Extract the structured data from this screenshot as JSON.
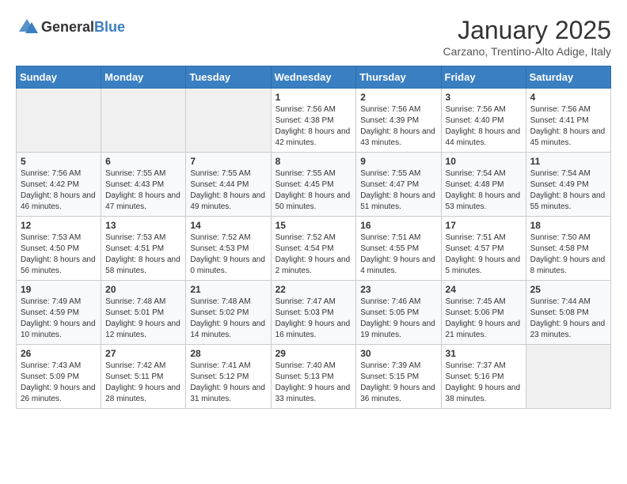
{
  "header": {
    "logo_general": "General",
    "logo_blue": "Blue",
    "month": "January 2025",
    "location": "Carzano, Trentino-Alto Adige, Italy"
  },
  "days_of_week": [
    "Sunday",
    "Monday",
    "Tuesday",
    "Wednesday",
    "Thursday",
    "Friday",
    "Saturday"
  ],
  "weeks": [
    [
      {
        "day": "",
        "sunrise": "",
        "sunset": "",
        "daylight": ""
      },
      {
        "day": "",
        "sunrise": "",
        "sunset": "",
        "daylight": ""
      },
      {
        "day": "",
        "sunrise": "",
        "sunset": "",
        "daylight": ""
      },
      {
        "day": "1",
        "sunrise": "Sunrise: 7:56 AM",
        "sunset": "Sunset: 4:38 PM",
        "daylight": "Daylight: 8 hours and 42 minutes."
      },
      {
        "day": "2",
        "sunrise": "Sunrise: 7:56 AM",
        "sunset": "Sunset: 4:39 PM",
        "daylight": "Daylight: 8 hours and 43 minutes."
      },
      {
        "day": "3",
        "sunrise": "Sunrise: 7:56 AM",
        "sunset": "Sunset: 4:40 PM",
        "daylight": "Daylight: 8 hours and 44 minutes."
      },
      {
        "day": "4",
        "sunrise": "Sunrise: 7:56 AM",
        "sunset": "Sunset: 4:41 PM",
        "daylight": "Daylight: 8 hours and 45 minutes."
      }
    ],
    [
      {
        "day": "5",
        "sunrise": "Sunrise: 7:56 AM",
        "sunset": "Sunset: 4:42 PM",
        "daylight": "Daylight: 8 hours and 46 minutes."
      },
      {
        "day": "6",
        "sunrise": "Sunrise: 7:55 AM",
        "sunset": "Sunset: 4:43 PM",
        "daylight": "Daylight: 8 hours and 47 minutes."
      },
      {
        "day": "7",
        "sunrise": "Sunrise: 7:55 AM",
        "sunset": "Sunset: 4:44 PM",
        "daylight": "Daylight: 8 hours and 49 minutes."
      },
      {
        "day": "8",
        "sunrise": "Sunrise: 7:55 AM",
        "sunset": "Sunset: 4:45 PM",
        "daylight": "Daylight: 8 hours and 50 minutes."
      },
      {
        "day": "9",
        "sunrise": "Sunrise: 7:55 AM",
        "sunset": "Sunset: 4:47 PM",
        "daylight": "Daylight: 8 hours and 51 minutes."
      },
      {
        "day": "10",
        "sunrise": "Sunrise: 7:54 AM",
        "sunset": "Sunset: 4:48 PM",
        "daylight": "Daylight: 8 hours and 53 minutes."
      },
      {
        "day": "11",
        "sunrise": "Sunrise: 7:54 AM",
        "sunset": "Sunset: 4:49 PM",
        "daylight": "Daylight: 8 hours and 55 minutes."
      }
    ],
    [
      {
        "day": "12",
        "sunrise": "Sunrise: 7:53 AM",
        "sunset": "Sunset: 4:50 PM",
        "daylight": "Daylight: 8 hours and 56 minutes."
      },
      {
        "day": "13",
        "sunrise": "Sunrise: 7:53 AM",
        "sunset": "Sunset: 4:51 PM",
        "daylight": "Daylight: 8 hours and 58 minutes."
      },
      {
        "day": "14",
        "sunrise": "Sunrise: 7:52 AM",
        "sunset": "Sunset: 4:53 PM",
        "daylight": "Daylight: 9 hours and 0 minutes."
      },
      {
        "day": "15",
        "sunrise": "Sunrise: 7:52 AM",
        "sunset": "Sunset: 4:54 PM",
        "daylight": "Daylight: 9 hours and 2 minutes."
      },
      {
        "day": "16",
        "sunrise": "Sunrise: 7:51 AM",
        "sunset": "Sunset: 4:55 PM",
        "daylight": "Daylight: 9 hours and 4 minutes."
      },
      {
        "day": "17",
        "sunrise": "Sunrise: 7:51 AM",
        "sunset": "Sunset: 4:57 PM",
        "daylight": "Daylight: 9 hours and 5 minutes."
      },
      {
        "day": "18",
        "sunrise": "Sunrise: 7:50 AM",
        "sunset": "Sunset: 4:58 PM",
        "daylight": "Daylight: 9 hours and 8 minutes."
      }
    ],
    [
      {
        "day": "19",
        "sunrise": "Sunrise: 7:49 AM",
        "sunset": "Sunset: 4:59 PM",
        "daylight": "Daylight: 9 hours and 10 minutes."
      },
      {
        "day": "20",
        "sunrise": "Sunrise: 7:48 AM",
        "sunset": "Sunset: 5:01 PM",
        "daylight": "Daylight: 9 hours and 12 minutes."
      },
      {
        "day": "21",
        "sunrise": "Sunrise: 7:48 AM",
        "sunset": "Sunset: 5:02 PM",
        "daylight": "Daylight: 9 hours and 14 minutes."
      },
      {
        "day": "22",
        "sunrise": "Sunrise: 7:47 AM",
        "sunset": "Sunset: 5:03 PM",
        "daylight": "Daylight: 9 hours and 16 minutes."
      },
      {
        "day": "23",
        "sunrise": "Sunrise: 7:46 AM",
        "sunset": "Sunset: 5:05 PM",
        "daylight": "Daylight: 9 hours and 19 minutes."
      },
      {
        "day": "24",
        "sunrise": "Sunrise: 7:45 AM",
        "sunset": "Sunset: 5:06 PM",
        "daylight": "Daylight: 9 hours and 21 minutes."
      },
      {
        "day": "25",
        "sunrise": "Sunrise: 7:44 AM",
        "sunset": "Sunset: 5:08 PM",
        "daylight": "Daylight: 9 hours and 23 minutes."
      }
    ],
    [
      {
        "day": "26",
        "sunrise": "Sunrise: 7:43 AM",
        "sunset": "Sunset: 5:09 PM",
        "daylight": "Daylight: 9 hours and 26 minutes."
      },
      {
        "day": "27",
        "sunrise": "Sunrise: 7:42 AM",
        "sunset": "Sunset: 5:11 PM",
        "daylight": "Daylight: 9 hours and 28 minutes."
      },
      {
        "day": "28",
        "sunrise": "Sunrise: 7:41 AM",
        "sunset": "Sunset: 5:12 PM",
        "daylight": "Daylight: 9 hours and 31 minutes."
      },
      {
        "day": "29",
        "sunrise": "Sunrise: 7:40 AM",
        "sunset": "Sunset: 5:13 PM",
        "daylight": "Daylight: 9 hours and 33 minutes."
      },
      {
        "day": "30",
        "sunrise": "Sunrise: 7:39 AM",
        "sunset": "Sunset: 5:15 PM",
        "daylight": "Daylight: 9 hours and 36 minutes."
      },
      {
        "day": "31",
        "sunrise": "Sunrise: 7:37 AM",
        "sunset": "Sunset: 5:16 PM",
        "daylight": "Daylight: 9 hours and 38 minutes."
      },
      {
        "day": "",
        "sunrise": "",
        "sunset": "",
        "daylight": ""
      }
    ]
  ]
}
